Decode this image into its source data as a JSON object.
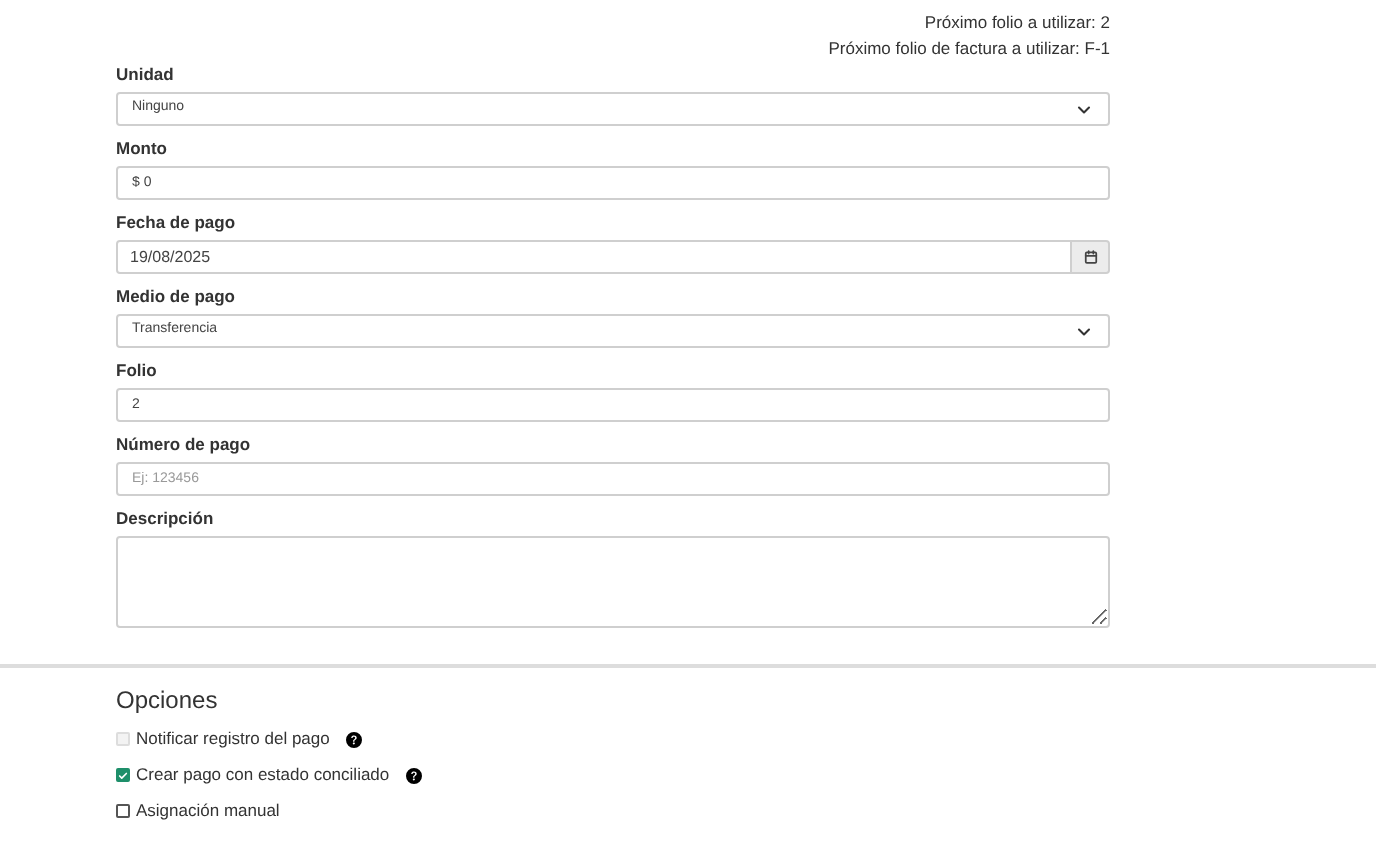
{
  "info": [
    "Próximo folio a utilizar: 2",
    "Próximo folio de factura a utilizar: F-1"
  ],
  "fields": [
    {
      "kind": "select",
      "label": "Unidad",
      "value": "Ninguno"
    },
    {
      "kind": "text",
      "label": "Monto",
      "value": "$ 0"
    },
    {
      "kind": "date",
      "label": "Fecha de pago",
      "value": "19/08/2025"
    },
    {
      "kind": "select",
      "label": "Medio de pago",
      "value": "Transferencia"
    },
    {
      "kind": "text",
      "label": "Folio",
      "value": "2"
    },
    {
      "kind": "text",
      "label": "Número de pago",
      "placeholder": "Ej: 123456"
    },
    {
      "kind": "textarea",
      "label": "Descripción"
    }
  ],
  "options_title": "Opciones",
  "options": [
    {
      "label": "Notificar registro del pago",
      "checked": false,
      "disabled": true,
      "help": true
    },
    {
      "label": "Crear pago con estado conciliado",
      "checked": true,
      "disabled": false,
      "help": true
    },
    {
      "label": "Asignación manual",
      "checked": false,
      "disabled": false,
      "help": false
    }
  ]
}
